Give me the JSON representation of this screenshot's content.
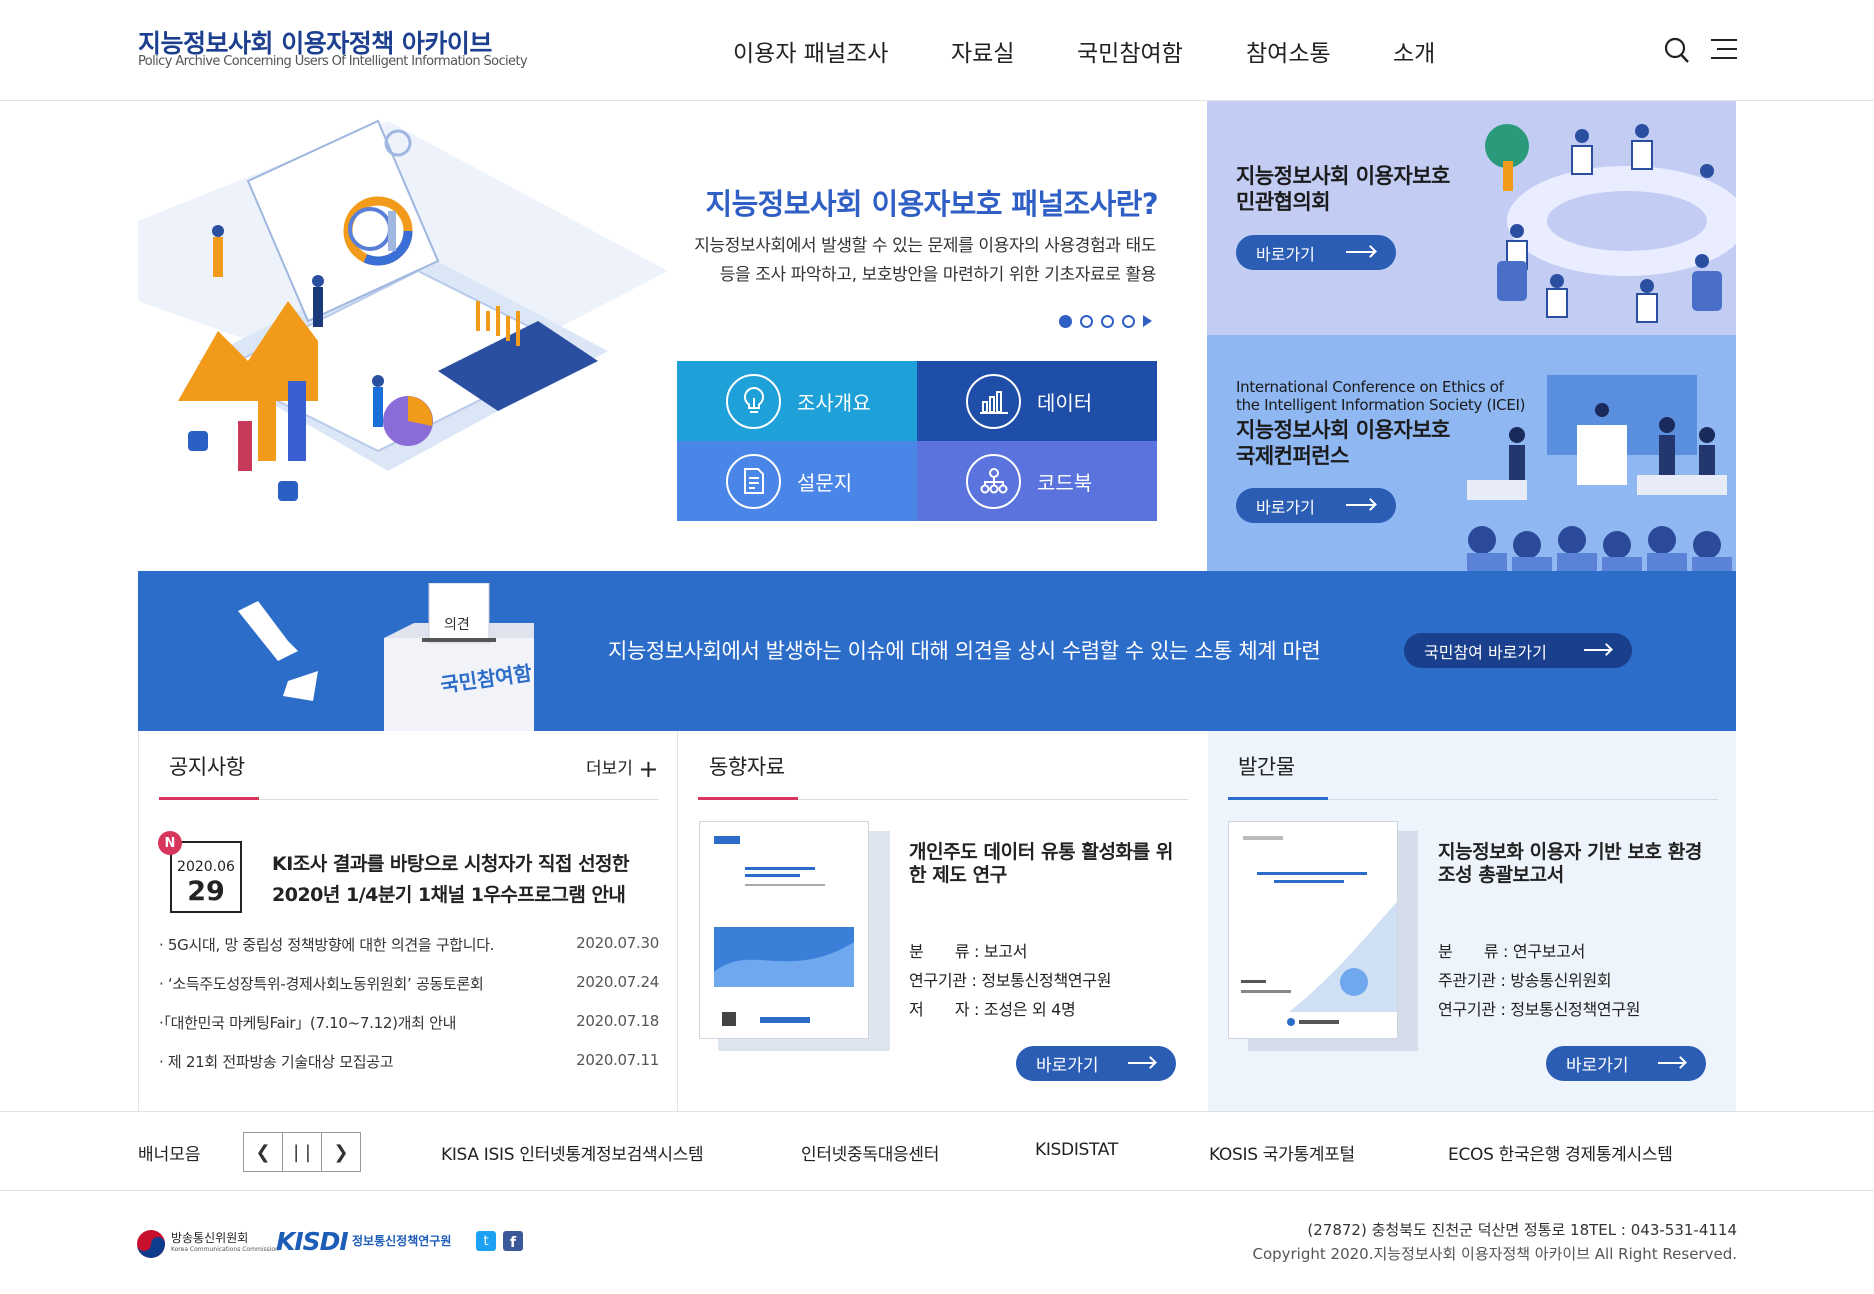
{
  "header": {
    "logo_title": "지능정보사회 이용자정책 아카이브",
    "logo_sub": "Policy Archive Concerning Users Of Intelligent Information Society",
    "nav": [
      "이용자 패널조사",
      "자료실",
      "국민참여함",
      "참여소통",
      "소개"
    ]
  },
  "hero": {
    "title": "지능정보사회 이용자보호 패널조사란?",
    "desc_line1": "지능정보사회에서 발생할 수 있는 문제를 이용자의 사용경험과 태도",
    "desc_line2": "등을 조사 파악하고, 보호방안을 마련하기 위한 기초자료로 활용",
    "tiles": [
      "조사개요",
      "데이터",
      "설문지",
      "코드북"
    ],
    "tile_colors": [
      "#1ea0d8",
      "#1f4ea8",
      "#4a86e8",
      "#5b73dc"
    ]
  },
  "panels": {
    "council": {
      "title_line1": "지능정보사회 이용자보호",
      "title_line2": "민관협의회",
      "button": "바로가기"
    },
    "conference": {
      "eng_line1": "International Conference on Ethics of",
      "eng_line2": "the Intelligent Information Society (ICEI)",
      "title_line1": "지능정보사회 이용자보호",
      "title_line2": "국제컨퍼런스",
      "button": "바로가기"
    }
  },
  "band": {
    "box_label": "의견",
    "box_text": "국민참여함",
    "text": "지능정보사회에서 발생하는 이슈에 대해 의견을 상시 수렴할 수 있는 소통 체계 마련",
    "button": "국민참여 바로가기"
  },
  "notice": {
    "heading": "공지사항",
    "more": "더보기",
    "badge": "N",
    "featured_date_ym": "2020.06",
    "featured_date_d": "29",
    "featured_line1": "KI조사 결과를 바탕으로 시청자가 직접 선정한",
    "featured_line2": "2020년 1/4분기 1채널 1우수프로그램 안내",
    "items": [
      {
        "title": "· 5G시대, 망 중립성 정책방향에 대한 의견을 구합니다.",
        "date": "2020.07.30"
      },
      {
        "title": "· ‘소득주도성장특위-경제사회노동위원회’ 공동토론회",
        "date": "2020.07.24"
      },
      {
        "title": "·「대한민국 마케팅Fair」(7.10~7.12)개최 안내",
        "date": "2020.07.18"
      },
      {
        "title": "· 제 21회 전파방송 기술대상 모집공고",
        "date": "2020.07.11"
      }
    ]
  },
  "trends": {
    "heading": "동향자료",
    "title_line1": "개인주도 데이터 유통 활성화를 위",
    "title_line2": "한 제도 연구",
    "meta": [
      {
        "label": "분　　류 : ",
        "value": "보고서"
      },
      {
        "label": "연구기관 : ",
        "value": "정보통신정책연구원"
      },
      {
        "label": "저　　자 : ",
        "value": "조성은 외 4명"
      }
    ],
    "button": "바로가기"
  },
  "publications": {
    "heading": "발간물",
    "title_line1": "지능정보화 이용자 기반 보호 환경",
    "title_line2": "조성 총괄보고서",
    "meta": [
      {
        "label": "분　　류 : ",
        "value": "연구보고서"
      },
      {
        "label": "주관기관 : ",
        "value": "방송통신위원회"
      },
      {
        "label": "연구기관 : ",
        "value": "정보통신정책연구원"
      }
    ],
    "button": "바로가기"
  },
  "banner": {
    "label": "배너모음",
    "links": [
      "KISA ISIS 인터넷통계정보검색시스템",
      "인터넷중독대응센터",
      "KISDISTAT",
      "KOSIS 국가통계포털",
      "ECOS 한국은행 경제통계시스템"
    ]
  },
  "footer": {
    "kcc_name": "방송통신위원회",
    "kcc_eng": "Korea Communications Commission",
    "kisdi": "KISDI",
    "kisdi_kor": "정보통신정책연구원",
    "address": "(27872) 충청북도 진천군 덕산면 정통로 18TEL : 043-531-4114",
    "copyright": "Copyright 2020.지능정보사회 이용자정책 아카이브 All Right Reserved."
  },
  "colors": {
    "brand": "#1d3f8f",
    "accent": "#2d6dca",
    "underline": "#d8355c"
  }
}
